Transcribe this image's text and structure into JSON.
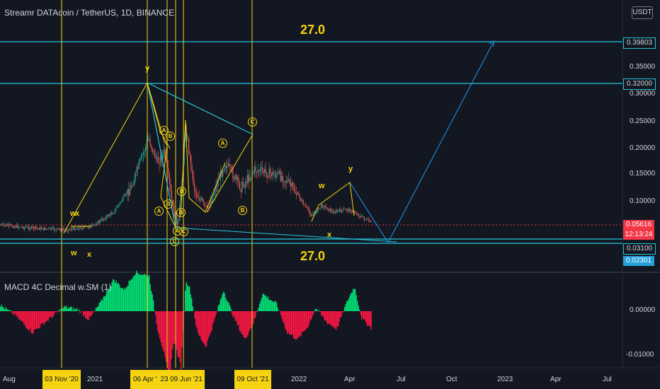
{
  "header": {
    "title": "Streamr DATAcoin / TetherUS, 1D, BINANCE",
    "currency": "USDT"
  },
  "indicator": {
    "title": "MACD 4C Decimal w.SM (1)"
  },
  "price_axis": {
    "labels": [
      "0.35000",
      "0.30000",
      "0.25000",
      "0.20000",
      "0.15000",
      "0.10000"
    ],
    "tags": [
      {
        "text": "0.39803",
        "color": "#26c6da"
      },
      {
        "text": "0.32000",
        "color": "#26c6da"
      },
      {
        "text": "0.05616",
        "color": "#f23645"
      },
      {
        "text": "12:13:24",
        "color": "#f23645"
      },
      {
        "text": "0.03100",
        "color": "#26c6da"
      },
      {
        "text": "0.02301",
        "color": "#26c6da"
      }
    ]
  },
  "macd_axis": {
    "labels": [
      "0.00000",
      "-0.01000"
    ]
  },
  "time_axis": {
    "labels": [
      "Aug",
      "2021",
      "2022",
      "Apr",
      "Jul",
      "Oct",
      "2023",
      "Apr",
      "Jul"
    ],
    "tags": [
      "03 Nov '20",
      "06 Apr '",
      "23",
      "09 Jun '21",
      "09 Oct '21"
    ]
  },
  "annotations": {
    "top_count": "27.0",
    "bottom_count": "27.0",
    "wave_labels": [
      "y",
      "w",
      "x",
      "w",
      "x",
      "w",
      "y",
      "x"
    ],
    "circled_labels": [
      "A",
      "B",
      "A",
      "B",
      "C",
      "B",
      "C",
      "A",
      "B",
      "C",
      "A",
      "B"
    ]
  },
  "colors": {
    "background": "#131722",
    "accent_yellow": "#f5d40f",
    "cyan": "#26c6da",
    "up": "#26a69a",
    "down": "#ef5350",
    "macd_up": "#00e676",
    "macd_down": "#ff1744"
  }
}
